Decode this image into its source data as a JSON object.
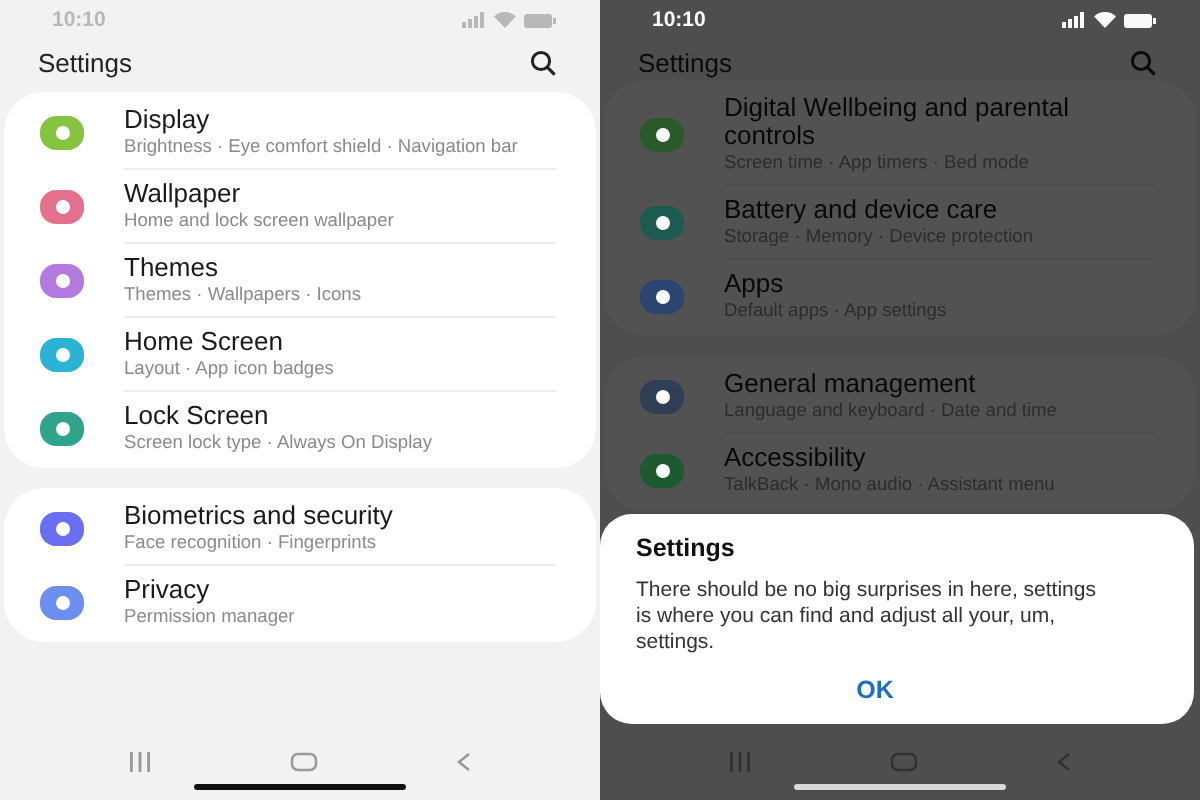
{
  "screens": [
    {
      "dimmed": false,
      "status_bar": {
        "time": "10:10"
      },
      "header": {
        "title": "Settings"
      },
      "groups": [
        {
          "items": [
            {
              "title": "Display",
              "subtitle": "Brightness · Eye comfort shield · Navigation bar",
              "color": "#86c440"
            },
            {
              "title": "Wallpaper",
              "subtitle": "Home and lock screen wallpaper",
              "color": "#e4708e"
            },
            {
              "title": "Themes",
              "subtitle": "Themes · Wallpapers · Icons",
              "color": "#b57ae0"
            },
            {
              "title": "Home Screen",
              "subtitle": "Layout · App icon badges",
              "color": "#2bb3d6"
            },
            {
              "title": "Lock Screen",
              "subtitle": "Screen lock type · Always On Display",
              "color": "#2ea58a"
            }
          ]
        },
        {
          "items": [
            {
              "title": "Biometrics and security",
              "subtitle": "Face recognition · Fingerprints",
              "color": "#6a6ef0"
            },
            {
              "title": "Privacy",
              "subtitle": "Permission manager",
              "color": "#6b8ef0"
            }
          ]
        }
      ]
    },
    {
      "dimmed": true,
      "status_bar": {
        "time": "10:10"
      },
      "header": {
        "title": "Settings"
      },
      "groups": [
        {
          "items": [
            {
              "title": "Digital Wellbeing and parental controls",
              "subtitle": "Screen time · App timers · Bed mode",
              "color": "#2a5a2a"
            },
            {
              "title": "Battery and device care",
              "subtitle": "Storage · Memory · Device protection",
              "color": "#1d5a50"
            },
            {
              "title": "Apps",
              "subtitle": "Default apps · App settings",
              "color": "#2a4570"
            }
          ]
        },
        {
          "items": [
            {
              "title": "General management",
              "subtitle": "Language and keyboard · Date and time",
              "color": "#2e3f55"
            },
            {
              "title": "Accessibility",
              "subtitle": "TalkBack · Mono audio · Assistant menu",
              "color": "#1e5a30"
            }
          ]
        }
      ],
      "dialog": {
        "title": "Settings",
        "message": "There should be no big surprises in here, settings is where you can find and adjust all your, um, settings.",
        "button": "OK"
      }
    }
  ]
}
